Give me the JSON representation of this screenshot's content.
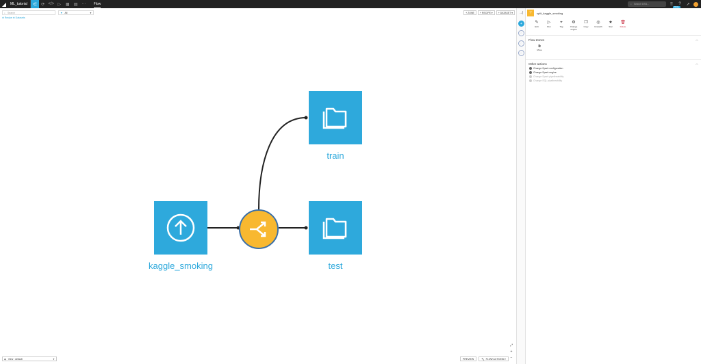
{
  "topbar": {
    "project": "ML_tutorial",
    "current_view": "Flow",
    "search_placeholder": "Search DSS...",
    "trial_badge": "TRIAL"
  },
  "filters": {
    "search_placeholder": "Search",
    "tags_value": "All"
  },
  "breadcrumb": "⊕ Recipe ⊕ Datasets",
  "top_actions": {
    "zone": "+ ZONE",
    "recipe": "+ RECIPE ▾",
    "dataset": "+ DATASET ▾"
  },
  "flow": {
    "source_dataset": "kaggle_smoking",
    "output_train": "train",
    "output_test": "test"
  },
  "bottom": {
    "view": "View : default",
    "preview": "PREVIEW",
    "flow_actions": "FLOW ACTIONS ▾"
  },
  "panel": {
    "title": "split_kaggle_smoking",
    "actions": [
      {
        "label": "Edit",
        "icon": "pencil-icon"
      },
      {
        "label": "Run",
        "icon": "play-icon"
      },
      {
        "label": "Tag",
        "icon": "tag-icon"
      },
      {
        "label": "Change engine",
        "icon": "gear-icon"
      },
      {
        "label": "Copy",
        "icon": "copy-icon"
      },
      {
        "label": "Unwatch",
        "icon": "eye-off-icon"
      },
      {
        "label": "Star",
        "icon": "star-icon"
      },
      {
        "label": "Delete",
        "icon": "trash-icon"
      }
    ],
    "flow_zones_title": "Flow Zones",
    "zone_move_label": "Move",
    "other_actions_title": "Other actions",
    "other_actions": [
      {
        "label": "Change Spark configuration",
        "enabled": true
      },
      {
        "label": "Change Spark engine",
        "enabled": true
      },
      {
        "label": "Change Spark pipelineability",
        "enabled": false
      },
      {
        "label": "Change SQL pipelineability",
        "enabled": false
      }
    ]
  },
  "colors": {
    "dataset": "#2ea9dc",
    "recipe": "#f8b830",
    "recipe_border": "#3a6fa8",
    "delete": "#c8283c"
  }
}
